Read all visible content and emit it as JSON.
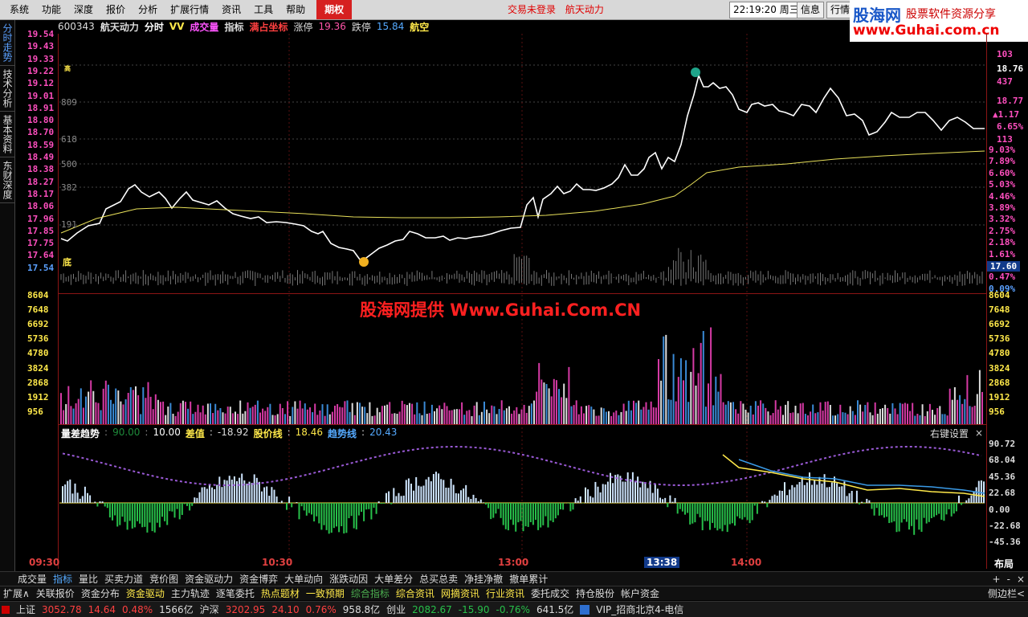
{
  "menu": {
    "items": [
      "系统",
      "功能",
      "深度",
      "报价",
      "分析",
      "扩展行情",
      "资讯",
      "工具",
      "帮助"
    ],
    "active": "期权",
    "login_status": "交易未登录",
    "stock_hint": "航天动力",
    "clock": "22:19:20",
    "weekday": "周三",
    "info_btn": "信息",
    "trade_btn": "行情"
  },
  "brand": {
    "name": "股海网",
    "subtitle": "股票软件资源分享",
    "url": "www.Guhai.com.cn"
  },
  "sidebar": {
    "tabs": [
      "分时走势",
      "技术分析",
      "基本资料",
      "东财深度"
    ]
  },
  "infobar": {
    "code": "600343",
    "name": "航天动力",
    "mode": "分时",
    "vv": "VV",
    "vol_label": "成交量",
    "indicator": "指标",
    "coord": "满占坐标",
    "up_label": "涨停",
    "up_value": "19.36",
    "down_label": "跌停",
    "down_value": "15.84",
    "signal": "航空"
  },
  "price_axis": {
    "left": [
      "19.54",
      "19.43",
      "19.33",
      "19.22",
      "19.12",
      "19.01",
      "18.91",
      "18.80",
      "18.70",
      "18.59",
      "18.49",
      "18.38",
      "18.27",
      "18.17",
      "18.06",
      "17.96",
      "17.85",
      "17.75",
      "17.64",
      "17.54"
    ],
    "right": [
      "9.03%",
      "7.89%",
      "6.60%",
      "5.03%",
      "4.46%",
      "3.89%",
      "3.32%",
      "2.75%",
      "2.18%",
      "1.61%",
      "1.04%",
      "0.47%",
      "0.09%"
    ],
    "depth_left": [
      "809",
      "618",
      "500",
      "382",
      "191"
    ],
    "right_top": [
      "103",
      "18.76",
      "437",
      "18.77",
      "1.17",
      "6.65%",
      "113"
    ],
    "current": "17.60",
    "low_mark": "底",
    "high_mark": "高"
  },
  "volume_axis": {
    "left": [
      "8604",
      "7648",
      "6692",
      "5736",
      "4780",
      "3824",
      "2868",
      "1912",
      "956"
    ],
    "right": [
      "8604",
      "7648",
      "6692",
      "5736",
      "4780",
      "3824",
      "2868",
      "1912",
      "956"
    ]
  },
  "indicator": {
    "title": "量差趋势",
    "p1": "90.00",
    "p2": "10.00",
    "diff_label": "差值",
    "diff_value": "-18.92",
    "price_label": "股价线",
    "price_value": "18.46",
    "trend_label": "趋势线",
    "trend_value": "20.43",
    "settings": "右键设置",
    "axis": [
      "90.72",
      "68.04",
      "45.36",
      "22.68",
      "0.00",
      "-22.68",
      "-45.36"
    ]
  },
  "watermark": "股海网提供 Www.Guhai.Com.CN",
  "time_axis": [
    "09:30",
    "10:30",
    "13:00",
    "13:38",
    "14:00"
  ],
  "layout_btn": "布局",
  "tabs_row1": [
    "成交量",
    "指标",
    "量比",
    "买卖力道",
    "竞价图",
    "资金驱动力",
    "资金博弈",
    "大单动向",
    "涨跌动因",
    "大单差分",
    "总买总卖",
    "净挂净撤",
    "撤单累计"
  ],
  "tabs_row1_active": "指标",
  "tabs_row2": [
    "扩展∧",
    "关联报价",
    "资金分布",
    "资金驱动",
    "主力轨迹",
    "逐笔委托",
    "热点题材",
    "一致预期",
    "综合指标",
    "综合资讯",
    "网摘资讯",
    "行业资讯",
    "委托成交",
    "持仓股份",
    "帐户资金"
  ],
  "tabs_row2_right": "侧边栏<",
  "status": {
    "sh_label": "上证",
    "sh_value": "3052.78",
    "sh_change": "14.64",
    "sh_pct": "0.48%",
    "sh_amount": "1566亿",
    "hs_label": "沪深",
    "hs_value": "3202.95",
    "hs_change": "24.10",
    "hs_pct": "0.76%",
    "hs_amount": "958.8亿",
    "cy_label": "创业",
    "cy_value": "2082.67",
    "cy_change": "-15.90",
    "cy_pct": "-0.76%",
    "cy_amount": "641.5亿",
    "server": "VIP_招商北京4-电信"
  },
  "colors": {
    "up": "#ff3b3b",
    "down": "#27c04a",
    "price_line": "#ffffff",
    "avg_line": "#e8e05a",
    "grid": "#8b1515"
  }
}
